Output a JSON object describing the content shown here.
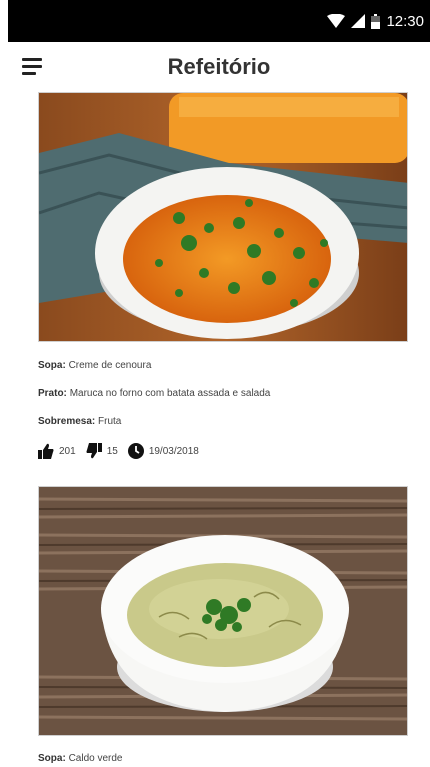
{
  "status_bar": {
    "time": "12:30",
    "icons": [
      "wifi-icon",
      "signal-icon",
      "battery-icon"
    ]
  },
  "app_bar": {
    "title": "Refeitório",
    "menu_icon": "hamburger-menu-icon"
  },
  "posts": [
    {
      "image": "carrot-soup-photo",
      "soup_label": "Sopa:",
      "soup": "Creme de cenoura",
      "main_label": "Prato:",
      "main": "Maruca no forno com batata assada e salada",
      "dessert_label": "Sobremesa:",
      "dessert": "Fruta",
      "likes": "201",
      "dislikes": "15",
      "date": "19/03/2018"
    },
    {
      "image": "caldo-verde-photo",
      "soup_label": "Sopa:",
      "soup": "Caldo verde"
    }
  ],
  "colors": {
    "status_bar": "#000000",
    "title": "#333333",
    "text": "#444444"
  }
}
